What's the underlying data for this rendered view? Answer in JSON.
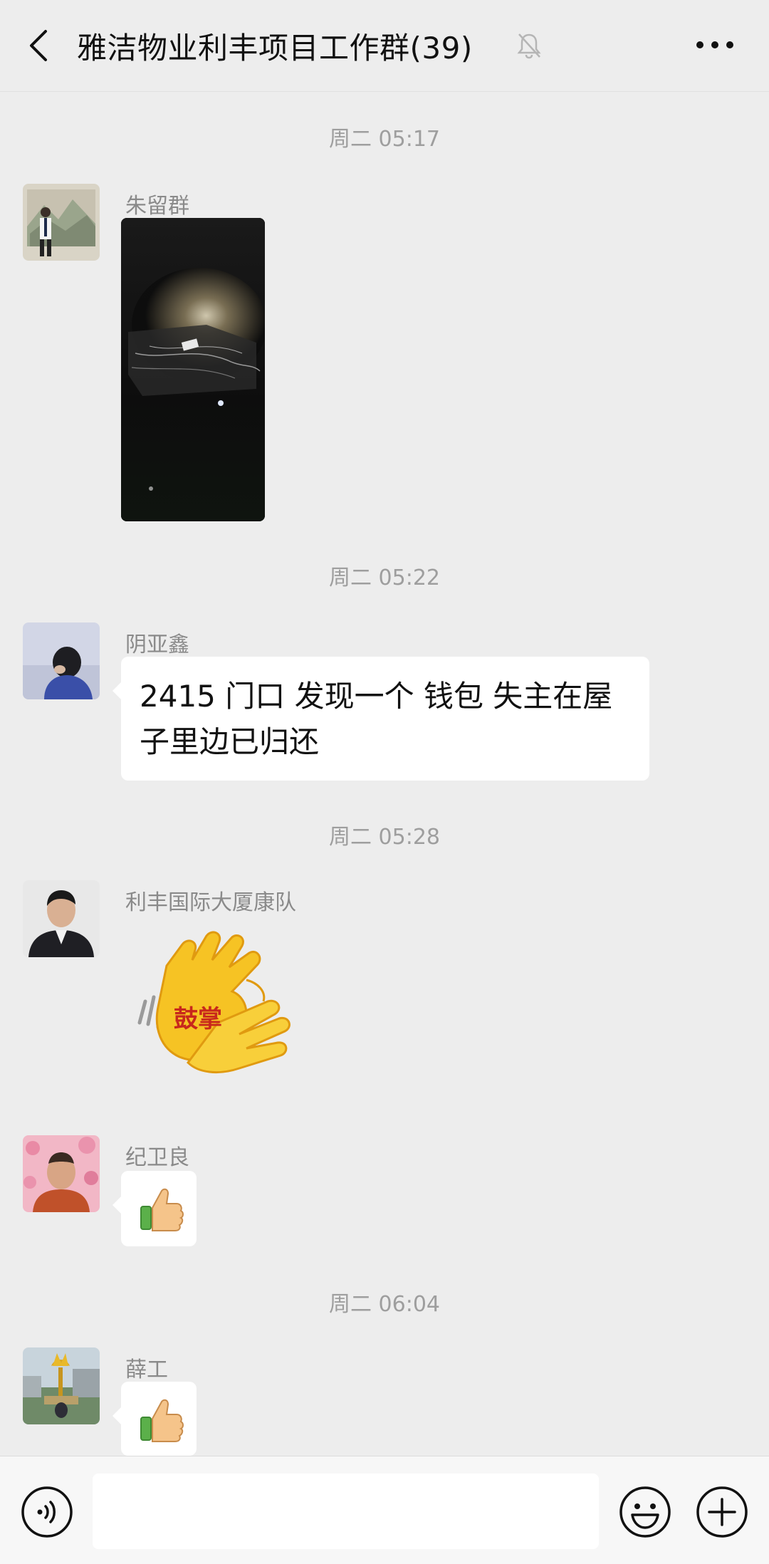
{
  "header": {
    "title": "雅洁物业利丰项目工作群(39)"
  },
  "messages": [
    {
      "time": "周二 05:17",
      "sender": "朱留群",
      "type": "image"
    },
    {
      "time": "周二 05:22",
      "sender": "阴亚鑫",
      "type": "text",
      "line1": "2415 门口 发现一个 钱包 失主在屋",
      "line2": "子里边已归还"
    },
    {
      "time": "周二 05:28",
      "sender": "利丰国际大厦康队",
      "type": "sticker",
      "sticker_text": "鼓掌"
    },
    {
      "sender": "纪卫良",
      "type": "emoji",
      "emoji": "👍"
    },
    {
      "time": "周二 06:04",
      "sender": "薛工",
      "type": "emoji",
      "emoji": "👍"
    }
  ],
  "input": {
    "placeholder": ""
  },
  "colors": {
    "background": "#ededed",
    "bubble": "#ffffff",
    "timestamp": "#9e9e9e"
  }
}
